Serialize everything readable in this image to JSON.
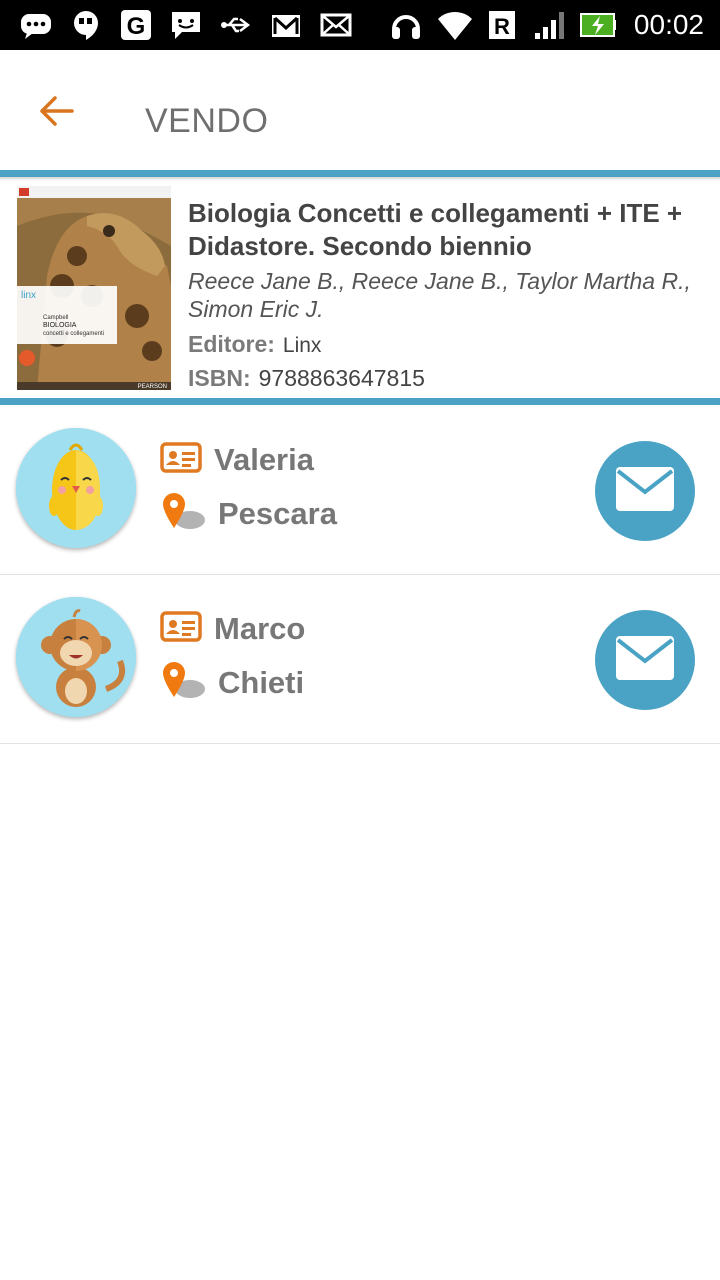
{
  "status_bar": {
    "time": "00:02",
    "icons": [
      "chat-bubble-icon",
      "hangouts-icon",
      "google-icon",
      "sms-icon",
      "usb-icon",
      "gmail-icon",
      "email-icon",
      "headset-icon",
      "wifi-icon",
      "roaming-icon",
      "signal-icon",
      "battery-charging-icon"
    ],
    "roaming_label": "R"
  },
  "app_bar": {
    "title": "VENDO",
    "back_icon": "arrow-left-icon",
    "accent_color": "#e07a22"
  },
  "book": {
    "title": "Biologia Concetti e collegamenti + ITE + Didastore. Secondo biennio",
    "authors": "Reece Jane B., Reece Jane B., Taylor Martha R., Simon Eric J.",
    "publisher_label": "Editore:",
    "publisher": "Linx",
    "isbn_label": "ISBN:",
    "isbn": "9788863647815",
    "cover": {
      "brand": "linx",
      "author": "Campbell",
      "series": "BIOLOGIA",
      "subtitle": "concetti e collegamenti",
      "publisher_mark": "PEARSON"
    }
  },
  "sellers": [
    {
      "name": "Valeria",
      "city": "Pescara",
      "avatar": "chick-avatar-icon"
    },
    {
      "name": "Marco",
      "city": "Chieti",
      "avatar": "monkey-avatar-icon"
    }
  ],
  "colors": {
    "divider": "#4aa3c4",
    "mail_button": "#4aa3c4",
    "icon_orange": "#e07a22",
    "name_text": "#777777"
  }
}
